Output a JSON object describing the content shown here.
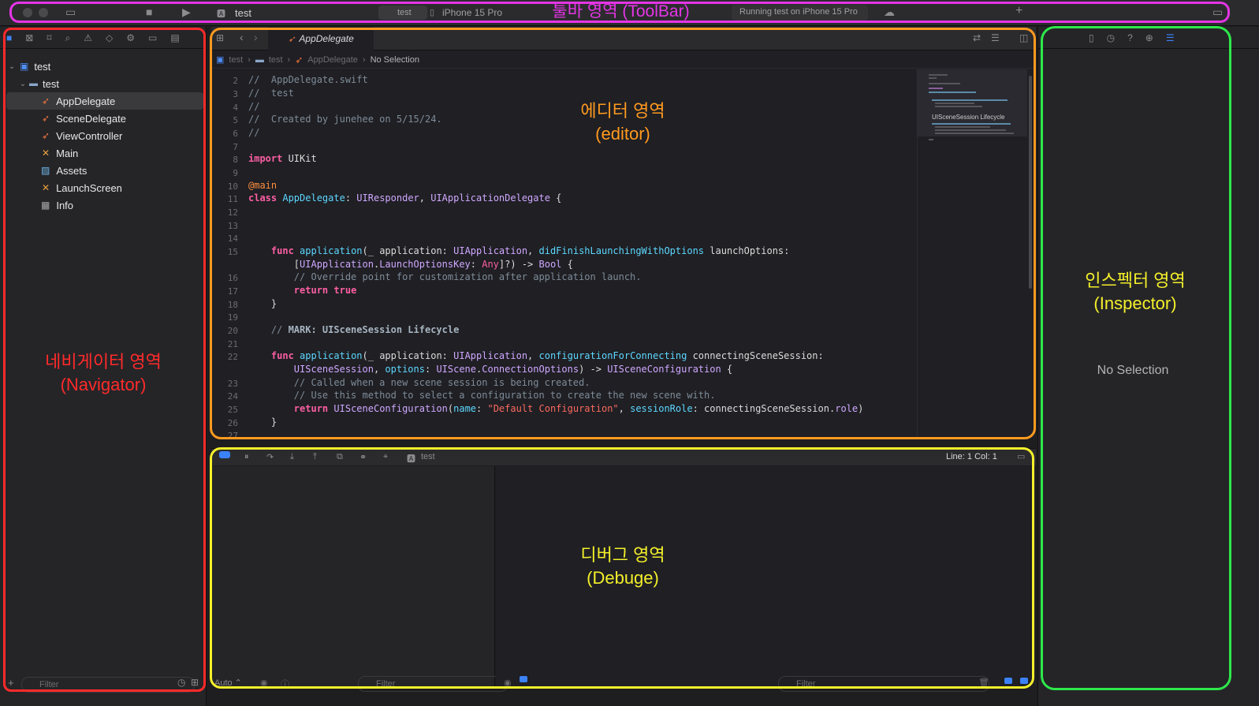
{
  "colors": {
    "toolbar_frame": "#e535e5",
    "navigator_frame": "#ff2a2a",
    "editor_frame": "#ff9a1f",
    "debug_frame": "#f4f02a",
    "inspector_frame": "#2ee84a"
  },
  "toolbar": {
    "scheme_name": "test",
    "scheme_selector": "test",
    "device": "iPhone 15 Pro",
    "status": "Running test on iPhone 15 Pro",
    "add_icon": "+"
  },
  "navigator": {
    "items": [
      {
        "label": "test",
        "kind": "project",
        "expanded": true
      },
      {
        "label": "test",
        "kind": "folder",
        "expanded": true
      },
      {
        "label": "AppDelegate",
        "kind": "swift",
        "selected": true
      },
      {
        "label": "SceneDelegate",
        "kind": "swift"
      },
      {
        "label": "ViewController",
        "kind": "swift"
      },
      {
        "label": "Main",
        "kind": "storyboard"
      },
      {
        "label": "Assets",
        "kind": "assets"
      },
      {
        "label": "LaunchScreen",
        "kind": "storyboard"
      },
      {
        "label": "Info",
        "kind": "plist"
      }
    ],
    "filter_placeholder": "Filter"
  },
  "editor": {
    "tab_label": "AppDelegate",
    "breadcrumb": [
      "test",
      "test",
      "AppDelegate",
      "No Selection"
    ],
    "minimap_label": "UISceneSession Lifecycle"
  },
  "debug": {
    "target": "test",
    "cursor": "Line: 1  Col: 1",
    "auto_label": "Auto ⌃",
    "filter_left": "Filter",
    "filter_right": "Filter"
  },
  "inspector": {
    "empty_text": "No Selection"
  },
  "annotations": {
    "toolbar": "툴바 영역 (ToolBar)",
    "editor_line1": "에디터 영역",
    "editor_line2": "(editor)",
    "navigator_line1": "네비게이터 영역",
    "navigator_line2": "(Navigator)",
    "inspector_line1": "인스펙터 영역",
    "inspector_line2": "(Inspector)",
    "debug_line1": "디버그 영역",
    "debug_line2": "(Debuge)"
  }
}
